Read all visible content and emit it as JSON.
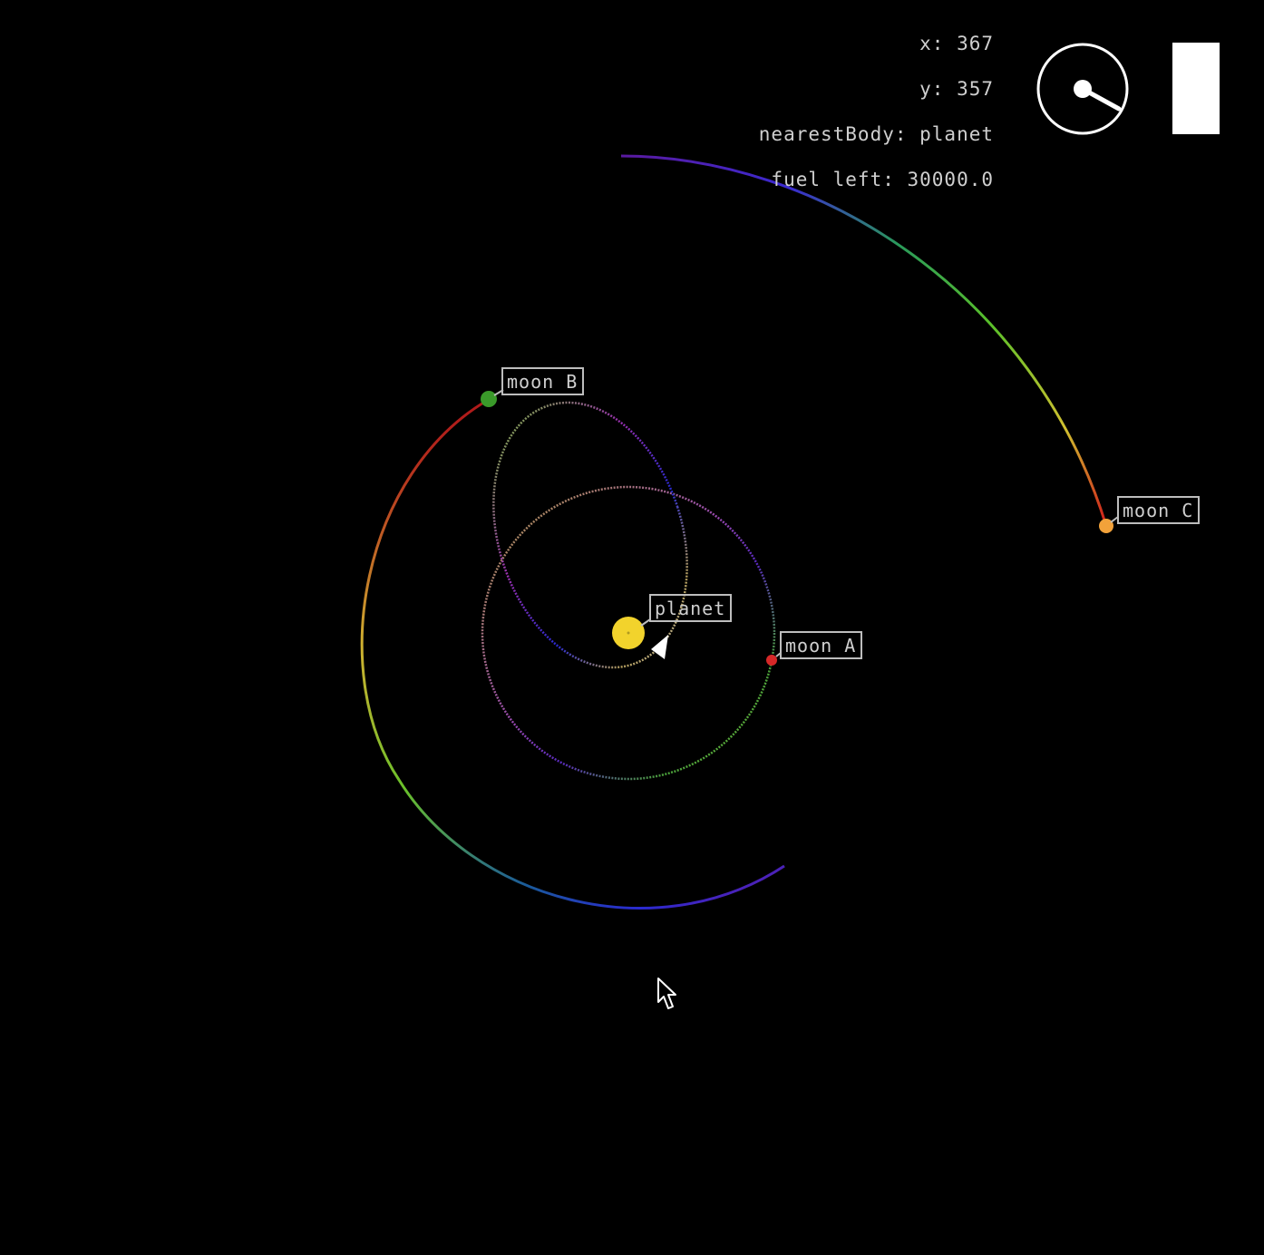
{
  "hud": {
    "x_text": "x: 367",
    "y_text": "y: 357",
    "nearest_text": "nearestBody: planet",
    "fuel_text": "fuel left: 30000.0"
  },
  "bodies": {
    "planet": {
      "label": "planet",
      "color": "#f2d32c"
    },
    "moon_a": {
      "label": "moon A",
      "color": "#d62828"
    },
    "moon_b": {
      "label": "moon B",
      "color": "#3a9a2a"
    },
    "moon_c": {
      "label": "moon C",
      "color": "#f2a23a"
    }
  },
  "ship": {
    "icon": "ship-icon",
    "color": "#ffffff"
  },
  "compass": {
    "icon": "heading-dial-icon"
  },
  "fuel_gauge": {
    "level": 1.0,
    "color": "#ffffff"
  },
  "cursor": {
    "icon": "mouse-pointer-icon"
  }
}
